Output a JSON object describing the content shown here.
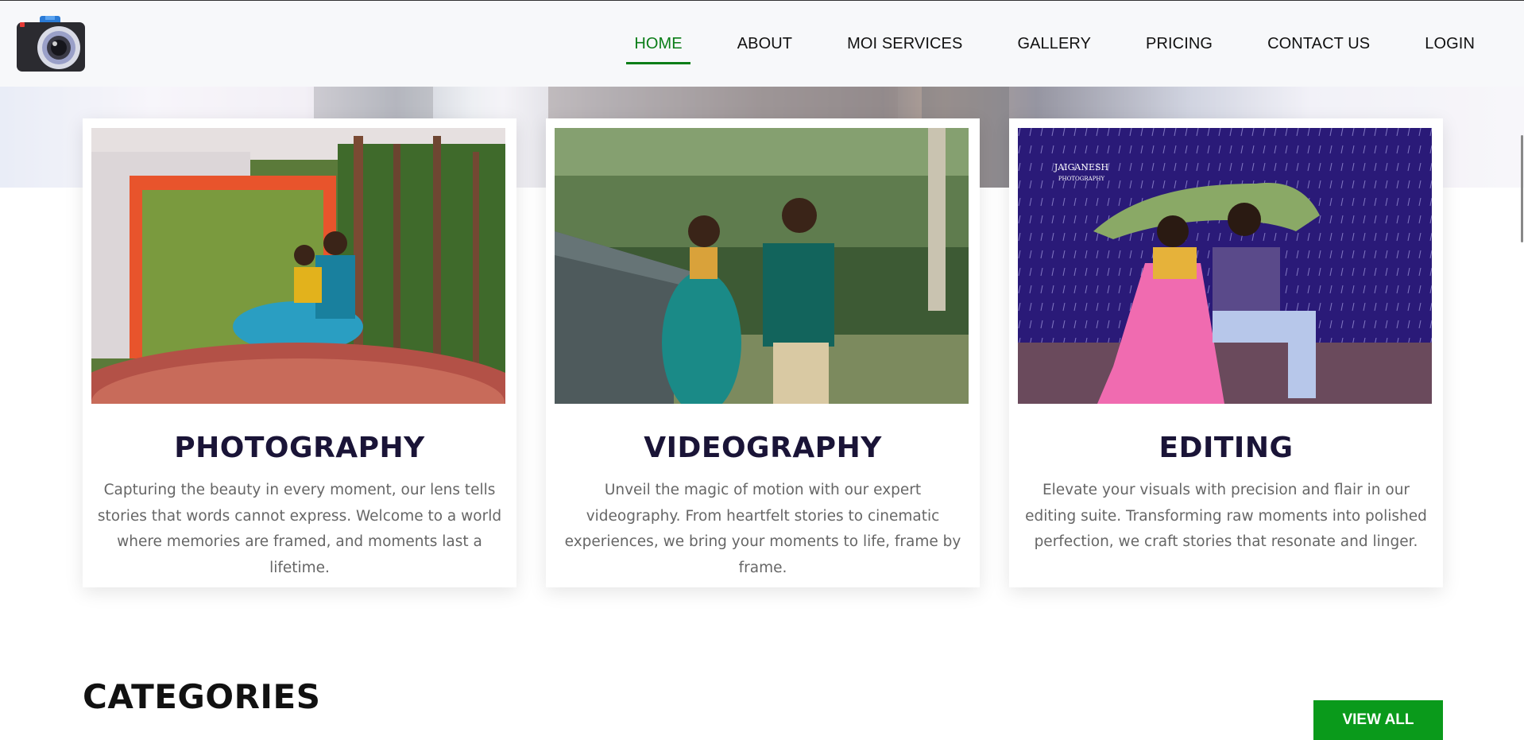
{
  "nav": {
    "items": [
      {
        "label": "HOME",
        "active": true
      },
      {
        "label": "ABOUT"
      },
      {
        "label": "MOI SERVICES"
      },
      {
        "label": "GALLERY"
      },
      {
        "label": "PRICING"
      },
      {
        "label": "CONTACT US"
      },
      {
        "label": "LOGIN"
      }
    ],
    "active_color": "#0a7d17"
  },
  "logo": {
    "icon": "camera-icon"
  },
  "services": [
    {
      "title": "PHOTOGRAPHY",
      "text": "Capturing the beauty in every moment, our lens tells stories that words cannot express. Welcome to a world where memories are framed, and moments last a lifetime."
    },
    {
      "title": "VIDEOGRAPHY",
      "text": "Unveil the magic of motion with our expert videography. From heartfelt stories to cinematic experiences, we bring your moments to life, frame by frame."
    },
    {
      "title": "EDITING",
      "text": "Elevate your visuals with precision and flair in our editing suite. Transforming raw moments into polished perfection, we craft stories that resonate and linger."
    }
  ],
  "watermark": {
    "line1": "JAIGANESH",
    "line2": "PHOTOGRAPHY"
  },
  "categories": {
    "title": "CATEGORIES",
    "button": "VIEW ALL"
  },
  "colors": {
    "title": "#1a1437",
    "button": "#0a9a1b",
    "body_text": "#666666"
  }
}
